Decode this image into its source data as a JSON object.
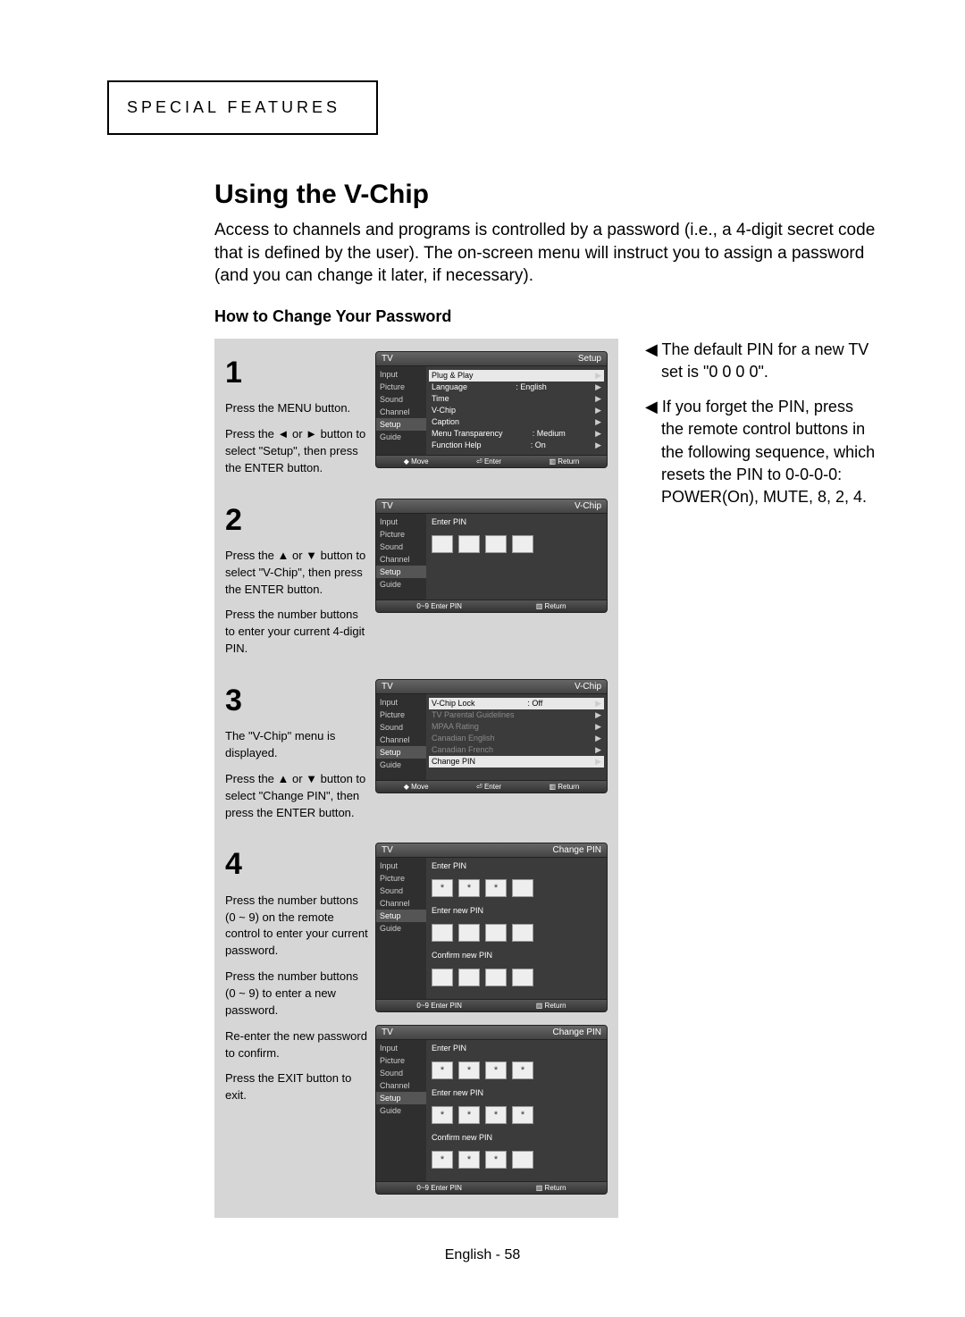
{
  "category": "SPECIAL FEATURES",
  "title": "Using the V-Chip",
  "intro": "Access to channels and programs is controlled by a password (i.e., a 4-digit secret code that is defined by the user). The on-screen menu will instruct you to assign a password (and you can change it later, if necessary).",
  "subhead": "How to Change Your Password",
  "footer": "English - 58",
  "steps": [
    {
      "num": "1",
      "para": [
        "Press the MENU button.",
        "Press the ◄ or ► button to select \"Setup\", then press the ENTER button."
      ]
    },
    {
      "num": "2",
      "para": [
        "Press the ▲ or ▼ button to select \"V-Chip\", then press the ENTER button.",
        "Press the number buttons to enter your current 4-digit PIN."
      ]
    },
    {
      "num": "3",
      "para": [
        "The \"V-Chip\" menu is displayed.",
        "Press the ▲ or ▼ button to select \"Change PIN\", then press the ENTER button."
      ]
    },
    {
      "num": "4",
      "para": [
        "Press the number buttons (0 ~ 9) on the remote control to enter your current password.",
        "Press the number buttons (0 ~ 9) to enter a new password.",
        "Re-enter the new password to confirm.",
        "Press the EXIT button to exit."
      ]
    }
  ],
  "osd": {
    "tv": "TV",
    "side": [
      "Input",
      "Picture",
      "Sound",
      "Channel",
      "Setup",
      "Guide"
    ],
    "foot_move": "Move",
    "foot_enter": "Enter",
    "foot_return": "Return",
    "foot_pin": "0~9 Enter PIN",
    "screen1": {
      "title": "Setup",
      "sel": "Setup",
      "rows": [
        {
          "l": "Plug & Play",
          "r": "",
          "hl": true
        },
        {
          "l": "Language",
          "r": ": English"
        },
        {
          "l": "Time",
          "r": ""
        },
        {
          "l": "V-Chip",
          "r": ""
        },
        {
          "l": "Caption",
          "r": ""
        },
        {
          "l": "Menu Transparency",
          "r": ": Medium"
        },
        {
          "l": "Function Help",
          "r": ": On"
        }
      ]
    },
    "screen2": {
      "title": "V-Chip",
      "sel": "Setup",
      "label": "Enter PIN"
    },
    "screen3": {
      "title": "V-Chip",
      "sel": "Setup",
      "rows": [
        {
          "l": "V-Chip Lock",
          "r": ": Off",
          "hl": true
        },
        {
          "l": "TV Parental Guidelines",
          "r": "",
          "dim": true
        },
        {
          "l": "MPAA Rating",
          "r": "",
          "dim": true
        },
        {
          "l": "Canadian English",
          "r": "",
          "dim": true
        },
        {
          "l": "Canadian French",
          "r": "",
          "dim": true
        },
        {
          "l": "Change PIN",
          "r": "",
          "hl": true
        }
      ]
    },
    "screen4a": {
      "title": "Change PIN",
      "sel": "Setup",
      "l1": "Enter PIN",
      "l2": "Enter new PIN",
      "l3": "Confirm new PIN",
      "fill": [
        true,
        true,
        true,
        false
      ]
    },
    "screen4b": {
      "title": "Change PIN",
      "sel": "Setup",
      "l1": "Enter PIN",
      "l2": "Enter new PIN",
      "l3": "Confirm new PIN"
    }
  },
  "notes": [
    "The default PIN for a new TV set is \"0 0 0 0\".",
    "If you forget the PIN, press the remote control buttons in the following sequence, which resets the PIN to 0-0-0-0: POWER(On), MUTE, 8, 2, 4."
  ]
}
